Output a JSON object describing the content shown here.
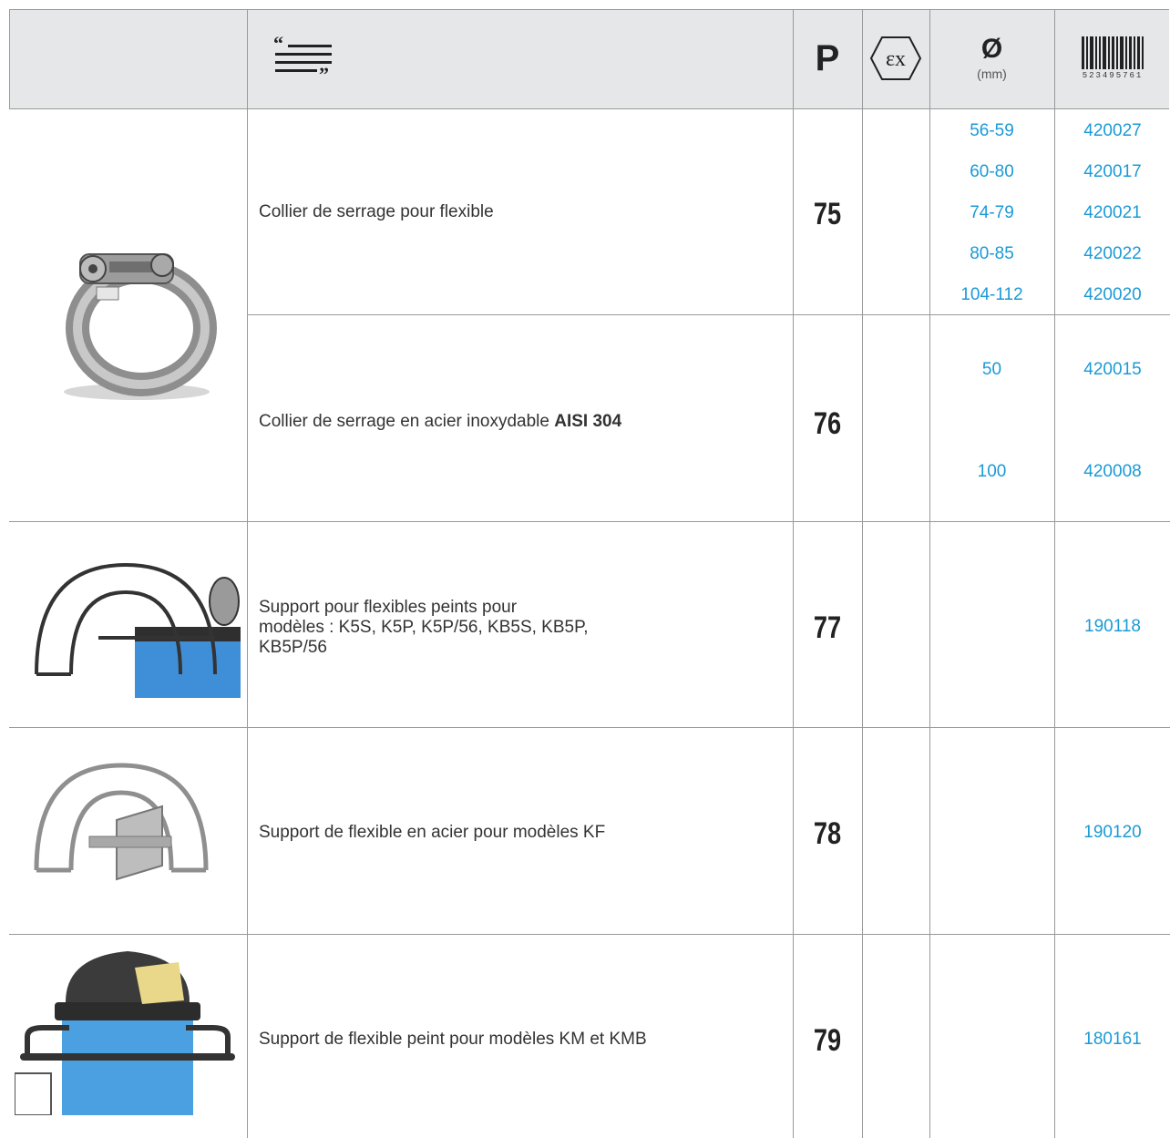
{
  "header": {
    "icons": [
      "description-quote-icon",
      "ex-atex-icon",
      "barcode-icon"
    ],
    "p_label": "P",
    "diameter_symbol": "Ø",
    "diameter_unit": "(mm)",
    "barcode_number": "523495761"
  },
  "rows": [
    {
      "description_text": "Collier de serrage pour flexible",
      "page": "75",
      "diameters": [
        "56-59",
        "60-80",
        "74-79",
        "80-85",
        "104-112"
      ],
      "codes": [
        "420027",
        "420017",
        "420021",
        "420022",
        "420020"
      ]
    },
    {
      "description_text": "Collier de serrage en acier inoxydable ",
      "description_bold": "AISI 304",
      "page": "76",
      "diameters": [
        "50",
        "100"
      ],
      "codes": [
        "420015",
        "420008"
      ]
    },
    {
      "description_lines": [
        "Support pour flexibles peints pour",
        "modèles : K5S, K5P, K5P/56, KB5S, KB5P,",
        "KB5P/56"
      ],
      "page": "77",
      "codes": [
        "190118"
      ]
    },
    {
      "description_text": "Support de flexible en acier pour modèles KF",
      "page": "78",
      "codes": [
        "190120"
      ]
    },
    {
      "description_text": "Support de flexible peint pour modèles KM et KMB",
      "page": "79",
      "codes": [
        "180161"
      ]
    }
  ],
  "colors": {
    "header_bg": "#e6e7e8",
    "link_blue": "#1a9ad6",
    "rule": "#999999"
  }
}
